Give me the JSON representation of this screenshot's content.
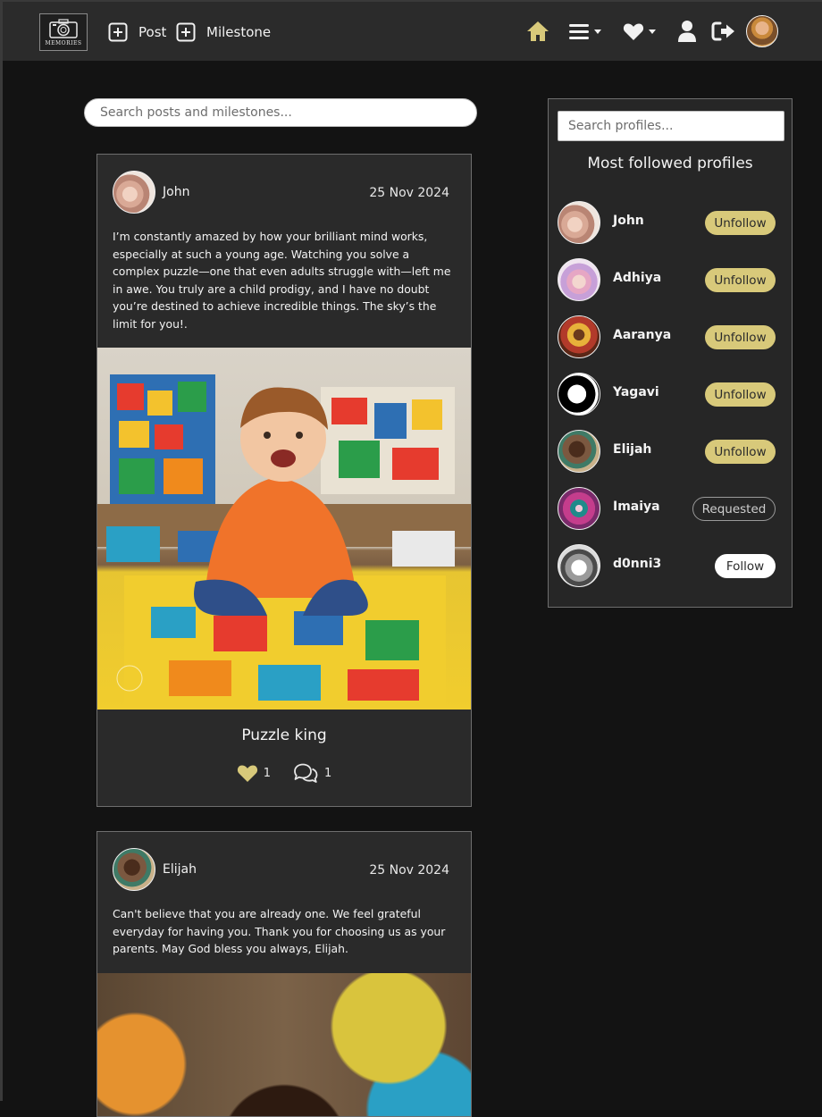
{
  "navbar": {
    "logo_text": "MEMORIES",
    "post_label": "Post",
    "milestone_label": "Milestone"
  },
  "search": {
    "posts_placeholder": "Search posts and milestones...",
    "profiles_placeholder": "Search profiles..."
  },
  "posts": [
    {
      "author": "John",
      "date": "25 Nov 2024",
      "text": "I’m constantly amazed by how your brilliant mind works, especially at such a young age. Watching you solve a complex puzzle—one that even adults struggle with—left me in awe. You truly are a child prodigy, and I have no doubt you’re destined to achieve incredible things. The sky’s the limit for you!.",
      "title": "Puzzle king",
      "likes": "1",
      "comments": "1"
    },
    {
      "author": "Elijah",
      "date": "25 Nov 2024",
      "text": "Can't believe that you are already one. We feel grateful everyday for having you. Thank you for choosing us as your parents. May God bless you always, Elijah."
    }
  ],
  "sidebar": {
    "heading": "Most followed profiles",
    "profiles": [
      {
        "name": "John",
        "button": "Unfollow"
      },
      {
        "name": "Adhiya",
        "button": "Unfollow"
      },
      {
        "name": "Aaranya",
        "button": "Unfollow"
      },
      {
        "name": "Yagavi",
        "button": "Unfollow"
      },
      {
        "name": "Elijah",
        "button": "Unfollow"
      },
      {
        "name": "Imaiya",
        "button": "Requested"
      },
      {
        "name": "d0nni3",
        "button": "Follow"
      }
    ]
  },
  "colors": {
    "accent": "#d8c97a",
    "background": "#131313",
    "navbar": "#2b2b2b",
    "card": "#2a2a2a"
  }
}
